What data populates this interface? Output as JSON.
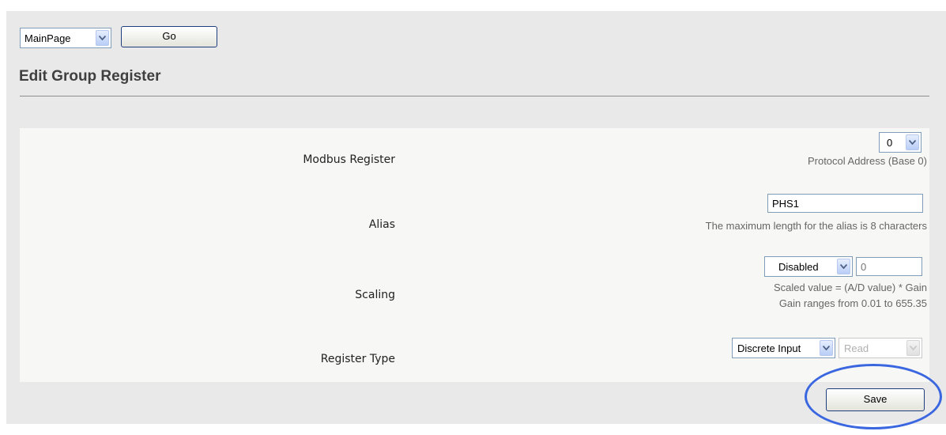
{
  "nav": {
    "page_select_value": "MainPage",
    "go_label": "Go"
  },
  "page_title": "Edit Group Register",
  "form": {
    "modbus_register": {
      "label": "Modbus Register",
      "value": "0",
      "hint": "Protocol Address (Base 0)"
    },
    "alias": {
      "label": "Alias",
      "value": "PHS1",
      "hint": "The maximum length for the alias is 8 characters"
    },
    "scaling": {
      "label": "Scaling",
      "mode_value": "Disabled",
      "gain_placeholder": "0",
      "hint_line1": "Scaled value = (A/D value) * Gain",
      "hint_line2": "Gain ranges from 0.01 to 655.35"
    },
    "register_type": {
      "label": "Register Type",
      "type_value": "Discrete Input",
      "access_value": "Read"
    }
  },
  "save_label": "Save",
  "colors": {
    "frame_bg": "#e9e9e9",
    "panel_bg": "#f7f7f5",
    "highlight": "#3a66e0"
  }
}
